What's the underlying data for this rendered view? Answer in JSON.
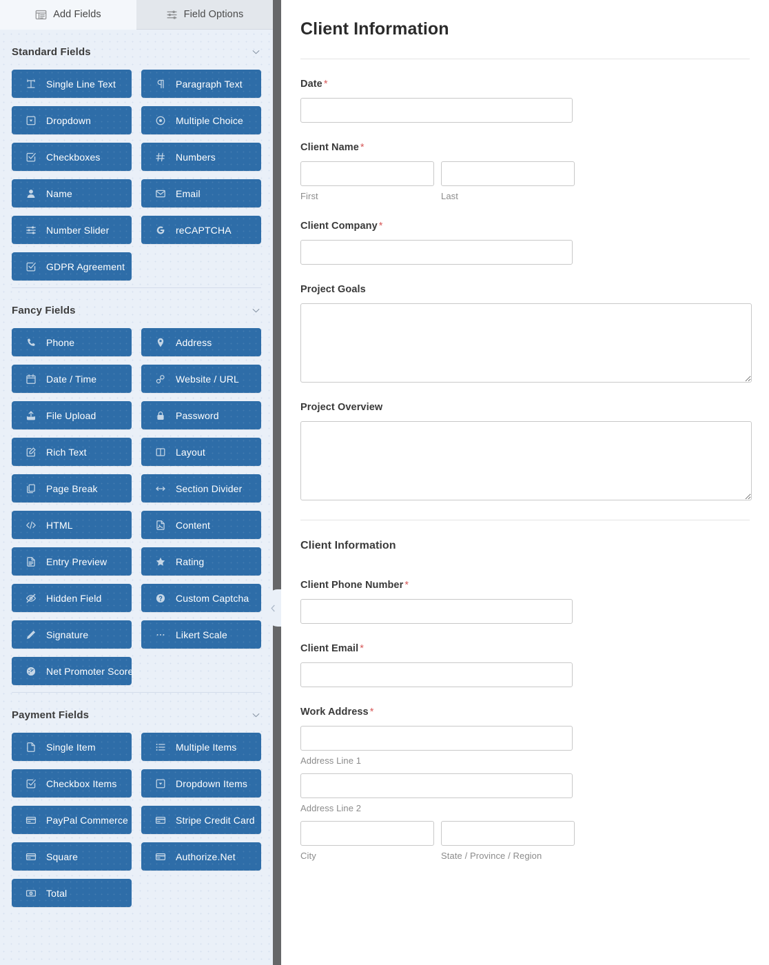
{
  "sidebar": {
    "tabs": [
      {
        "label": "Add Fields",
        "icon": "add-fields-icon",
        "active": true
      },
      {
        "label": "Field Options",
        "icon": "sliders-icon",
        "active": false
      }
    ],
    "sections": [
      {
        "title": "Standard Fields",
        "collapse_icon": "chevron-down-icon",
        "fields": [
          {
            "label": "Single Line Text",
            "icon": "text-cursor-icon"
          },
          {
            "label": "Paragraph Text",
            "icon": "pilcrow-icon"
          },
          {
            "label": "Dropdown",
            "icon": "caret-square-down-icon"
          },
          {
            "label": "Multiple Choice",
            "icon": "radio-circle-icon"
          },
          {
            "label": "Checkboxes",
            "icon": "check-square-icon"
          },
          {
            "label": "Numbers",
            "icon": "hash-icon"
          },
          {
            "label": "Name",
            "icon": "user-icon"
          },
          {
            "label": "Email",
            "icon": "envelope-icon"
          },
          {
            "label": "Number Slider",
            "icon": "sliders-icon"
          },
          {
            "label": "reCAPTCHA",
            "icon": "google-g-icon"
          },
          {
            "label": "GDPR Agreement",
            "icon": "check-square-icon"
          }
        ]
      },
      {
        "title": "Fancy Fields",
        "collapse_icon": "chevron-down-icon",
        "fields": [
          {
            "label": "Phone",
            "icon": "phone-icon"
          },
          {
            "label": "Address",
            "icon": "map-pin-icon"
          },
          {
            "label": "Date / Time",
            "icon": "calendar-icon"
          },
          {
            "label": "Website / URL",
            "icon": "link-icon"
          },
          {
            "label": "File Upload",
            "icon": "upload-icon"
          },
          {
            "label": "Password",
            "icon": "lock-icon"
          },
          {
            "label": "Rich Text",
            "icon": "pen-square-icon"
          },
          {
            "label": "Layout",
            "icon": "columns-icon"
          },
          {
            "label": "Page Break",
            "icon": "copy-pages-icon"
          },
          {
            "label": "Section Divider",
            "icon": "arrows-horizontal-icon"
          },
          {
            "label": "HTML",
            "icon": "code-icon"
          },
          {
            "label": "Content",
            "icon": "image-file-icon"
          },
          {
            "label": "Entry Preview",
            "icon": "document-lines-icon"
          },
          {
            "label": "Rating",
            "icon": "star-icon"
          },
          {
            "label": "Hidden Field",
            "icon": "eye-slash-icon"
          },
          {
            "label": "Custom Captcha",
            "icon": "question-circle-icon"
          },
          {
            "label": "Signature",
            "icon": "pencil-icon"
          },
          {
            "label": "Likert Scale",
            "icon": "dots-icon"
          },
          {
            "label": "Net Promoter Score",
            "icon": "gauge-icon"
          }
        ]
      },
      {
        "title": "Payment Fields",
        "collapse_icon": "chevron-down-icon",
        "fields": [
          {
            "label": "Single Item",
            "icon": "file-icon"
          },
          {
            "label": "Multiple Items",
            "icon": "list-icon"
          },
          {
            "label": "Checkbox Items",
            "icon": "check-square-icon"
          },
          {
            "label": "Dropdown Items",
            "icon": "caret-square-down-icon"
          },
          {
            "label": "PayPal Commerce",
            "icon": "credit-card-icon"
          },
          {
            "label": "Stripe Credit Card",
            "icon": "credit-card-icon"
          },
          {
            "label": "Square",
            "icon": "credit-card-icon"
          },
          {
            "label": "Authorize.Net",
            "icon": "credit-card-icon"
          },
          {
            "label": "Total",
            "icon": "money-bill-icon"
          }
        ]
      }
    ],
    "collapse_handle_icon": "chevron-left-icon"
  },
  "preview": {
    "form_title": "Client Information",
    "fields": [
      {
        "key": "date",
        "label": "Date",
        "required": true,
        "type": "text"
      },
      {
        "key": "client_name",
        "label": "Client Name",
        "required": true,
        "type": "name",
        "sub": [
          "First",
          "Last"
        ]
      },
      {
        "key": "client_company",
        "label": "Client Company",
        "required": true,
        "type": "text"
      },
      {
        "key": "project_goals",
        "label": "Project Goals",
        "required": false,
        "type": "textarea"
      },
      {
        "key": "project_overview",
        "label": "Project Overview",
        "required": false,
        "type": "textarea"
      }
    ],
    "section_title": "Client Information",
    "fields2": [
      {
        "key": "client_phone",
        "label": "Client Phone Number",
        "required": true,
        "type": "text"
      },
      {
        "key": "client_email",
        "label": "Client Email",
        "required": true,
        "type": "text"
      },
      {
        "key": "work_address",
        "label": "Work Address",
        "required": true,
        "type": "address",
        "sub": [
          "Address Line 1",
          "Address Line 2",
          "City",
          "State / Province / Region"
        ]
      }
    ]
  },
  "colors": {
    "field_button_blue": "#2e6da8",
    "sidebar_background": "#eaf0f8",
    "divider_bar": "#666769",
    "required_asterisk": "#d75a5a",
    "input_border": "#c8c8c8"
  }
}
